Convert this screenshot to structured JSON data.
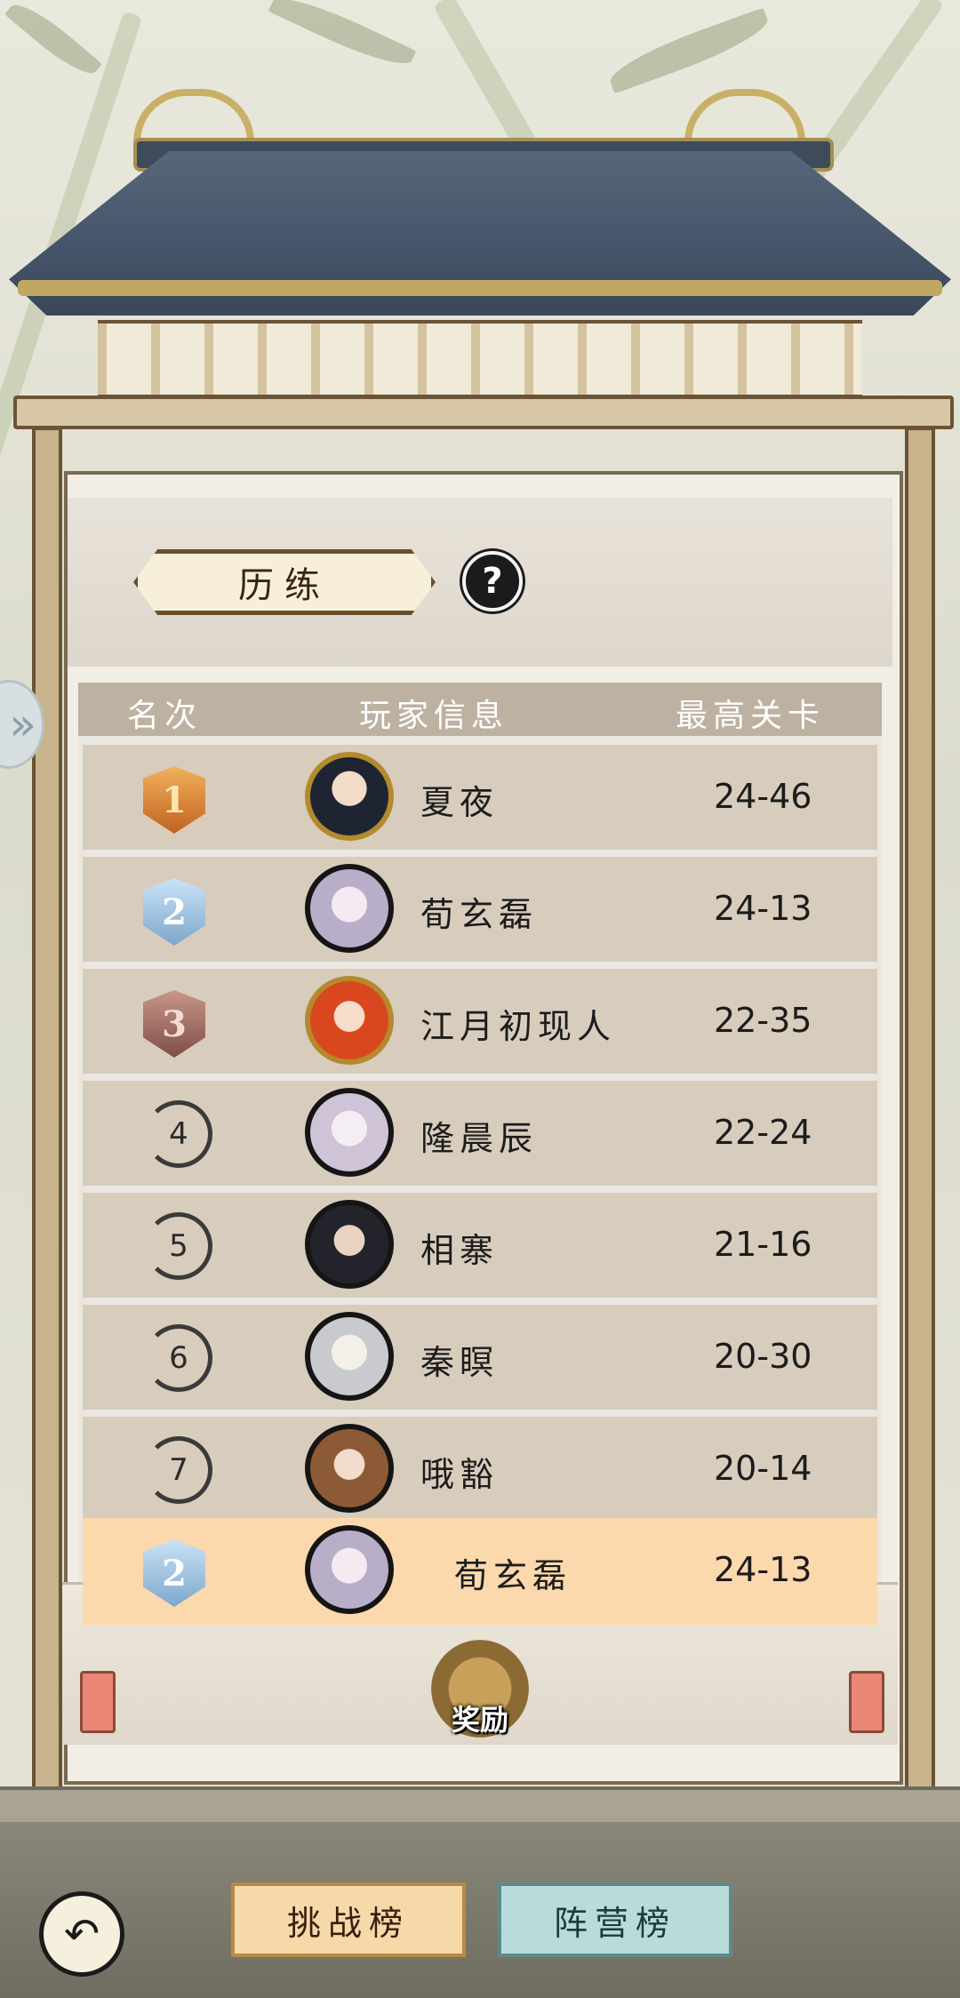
{
  "header": {
    "title": "历练",
    "help_icon": "question-circle-icon",
    "side_nav_icon": "chevron-right-icon"
  },
  "table": {
    "columns": [
      "名次",
      "玩家信息",
      "最高关卡"
    ],
    "rows": [
      {
        "rank": "1",
        "badge": "gold-badge",
        "name": "夏夜",
        "stage": "24-46"
      },
      {
        "rank": "2",
        "badge": "silver-badge",
        "name": "荀玄磊",
        "stage": "24-13"
      },
      {
        "rank": "3",
        "badge": "bronze-badge",
        "name": "江月初现人",
        "stage": "22-35"
      },
      {
        "rank": "4",
        "badge": "ring",
        "name": "隆晨辰",
        "stage": "22-24"
      },
      {
        "rank": "5",
        "badge": "ring",
        "name": "相寨",
        "stage": "21-16"
      },
      {
        "rank": "6",
        "badge": "ring",
        "name": "秦瞑",
        "stage": "20-30"
      },
      {
        "rank": "7",
        "badge": "ring",
        "name": "哦豁",
        "stage": "20-14"
      }
    ],
    "self_row": {
      "rank": "2",
      "badge": "silver-badge",
      "name": "荀玄磊",
      "stage": "24-13"
    }
  },
  "reward": {
    "label": "奖励",
    "icon": "treasure-chest-icon"
  },
  "footer": {
    "back_icon": "back-arrow-icon",
    "tabs": [
      "挑战榜",
      "阵营榜"
    ]
  },
  "colors": {
    "row_bg": "#d8ccbd",
    "self_row_bg": "#fcd8ad",
    "header_bg": "#bdb1a2"
  }
}
